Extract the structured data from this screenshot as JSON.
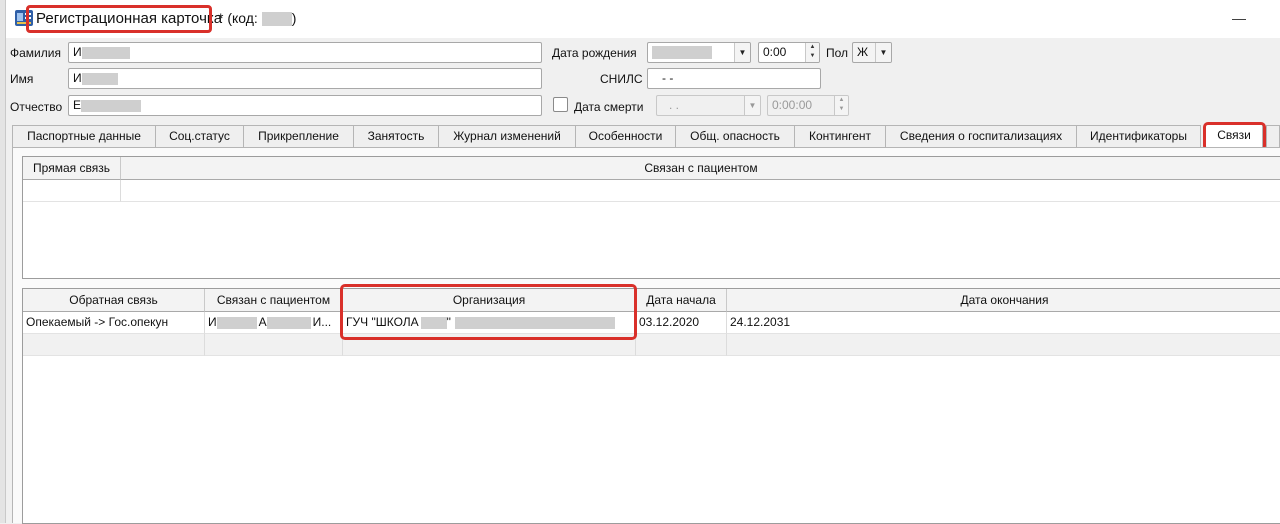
{
  "window": {
    "title": "Регистрационная карточка",
    "title_suffix": "* (код:",
    "title_suffix_end": ")",
    "highlight_color": "#d9302a"
  },
  "form": {
    "surname": {
      "label": "Фамилия",
      "value": "И"
    },
    "name": {
      "label": "Имя",
      "value": "И"
    },
    "patronymic": {
      "label": "Отчество",
      "value": "Е"
    },
    "birth_date": {
      "label": "Дата рождения",
      "time": "0:00"
    },
    "gender": {
      "label": "Пол",
      "value": "Ж"
    },
    "snils": {
      "label": "СНИЛС",
      "value": "-  -"
    },
    "death_date": {
      "label": "Дата смерти",
      "value": ". .",
      "time": "0:00:00"
    }
  },
  "tabs": [
    "Паспортные данные",
    "Соц.статус",
    "Прикрепление",
    "Занятость",
    "Журнал изменений",
    "Особенности",
    "Общ. опасность",
    "Контингент",
    "Сведения о госпитализациях",
    "Идентификаторы",
    "Связи"
  ],
  "active_tab": "Связи",
  "direct_links_table": {
    "columns": [
      "Прямая связь",
      "Связан с пациентом"
    ],
    "rows": []
  },
  "reverse_links_table": {
    "columns": [
      "Обратная связь",
      "Связан с пациентом",
      "Организация",
      "Дата начала",
      "Дата окончания"
    ],
    "rows": [
      {
        "link_type": "Опекаемый -> Гос.опекун",
        "patient_parts": [
          "И",
          "А",
          "И..."
        ],
        "org": "ГУЧ \"ШКОЛА",
        "org_quote": "\"",
        "start": "03.12.2020",
        "end": "24.12.2031"
      }
    ]
  }
}
